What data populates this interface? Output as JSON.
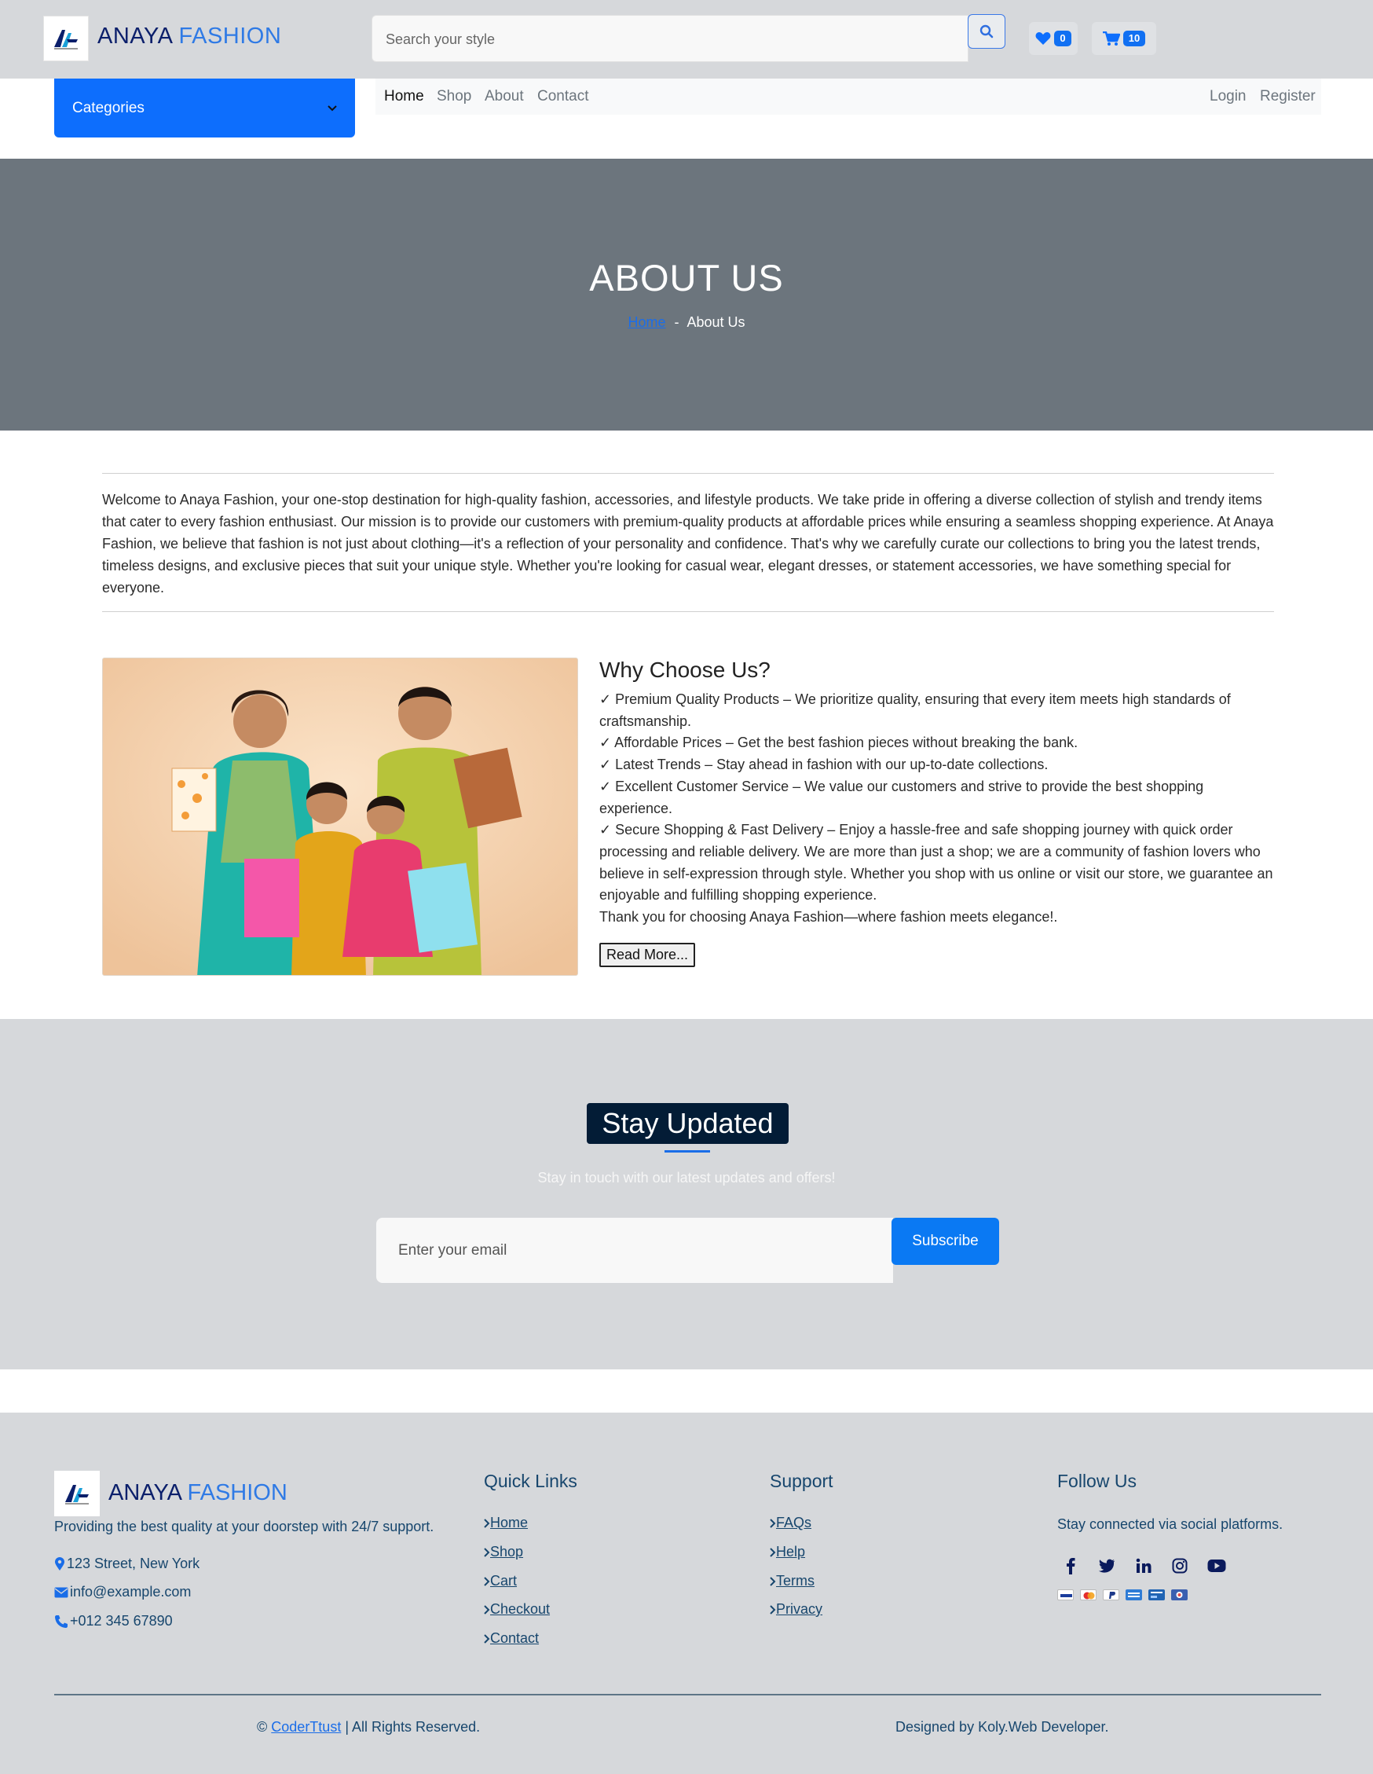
{
  "header": {
    "brand_part1": "ANAYA",
    "brand_part2": "FASHION",
    "search_placeholder": "Search your style",
    "wishlist_count": "0",
    "cart_count": "10"
  },
  "nav": {
    "categories_label": "Categories",
    "links": [
      "Home",
      "Shop",
      "About",
      "Contact"
    ],
    "active_link": "Home",
    "login_label": "Login",
    "register_label": "Register"
  },
  "hero": {
    "title": "ABOUT US",
    "breadcrumb_home": "Home",
    "breadcrumb_separator": "-",
    "breadcrumb_current": "About Us"
  },
  "about": {
    "intro": "Welcome to Anaya Fashion, your one-stop destination for high-quality fashion, accessories, and lifestyle products. We take pride in offering a diverse collection of stylish and trendy items that cater to every fashion enthusiast. Our mission is to provide our customers with premium-quality products at affordable prices while ensuring a seamless shopping experience. At Anaya Fashion, we believe that fashion is not just about clothing—it's a reflection of your personality and confidence. That's why we carefully curate our collections to bring you the latest trends, timeless designs, and exclusive pieces that suit your unique style. Whether you're looking for casual wear, elegant dresses, or statement accessories, we have something special for everyone.",
    "why_title": "Why Choose Us?",
    "why_points": [
      "✓ Premium Quality Products – We prioritize quality, ensuring that every item meets high standards of craftsmanship.",
      "✓ Affordable Prices – Get the best fashion pieces without breaking the bank.",
      "✓ Latest Trends – Stay ahead in fashion with our up-to-date collections.",
      "✓ Excellent Customer Service – We value our customers and strive to provide the best shopping experience.",
      "✓ Secure Shopping & Fast Delivery – Enjoy a hassle-free and safe shopping journey with quick order processing and reliable delivery. We are more than just a shop; we are a community of fashion lovers who believe in self-expression through style. Whether you shop with us online or visit our store, we guarantee an enjoyable and fulfilling shopping experience.",
      "Thank you for choosing Anaya Fashion—where fashion meets elegance!."
    ],
    "read_more": "Read More..."
  },
  "newsletter": {
    "title": "Stay Updated",
    "subtitle": "Stay in touch with our latest updates and offers!",
    "email_placeholder": "Enter your email",
    "subscribe_label": "Subscribe"
  },
  "footer": {
    "brand_part1": "ANAYA",
    "brand_part2": "FASHION",
    "tagline": "Providing the best quality at your doorstep with 24/7 support.",
    "address": "123 Street, New York",
    "email": "info@example.com",
    "phone": "+012 345 67890",
    "quick_links_title": "Quick Links",
    "quick_links": [
      "Home",
      "Shop",
      "Cart",
      "Checkout",
      "Contact"
    ],
    "support_title": "Support",
    "support_links": [
      "FAQs",
      "Help",
      "Terms",
      "Privacy"
    ],
    "follow_title": "Follow Us",
    "follow_text": "Stay connected via social platforms.",
    "social_icons": [
      "facebook-icon",
      "twitter-icon",
      "linkedin-icon",
      "instagram-icon",
      "youtube-icon"
    ],
    "payment_icons": [
      "visa-icon",
      "mastercard-icon",
      "paypal-icon",
      "amex-icon",
      "bank-card-icon",
      "diners-icon"
    ],
    "copyright_symbol": "©",
    "copyright_link": "CoderTtust",
    "copyright_rest": "| All Rights Reserved.",
    "designed_by": "Designed by Koly.Web Developer."
  },
  "colors": {
    "primary": "#0d6efd",
    "brand_dark": "#0b1f6b",
    "brand_light": "#2f7ae5",
    "header_bg": "#d6d8db",
    "hero_bg": "#6c757d",
    "newsletter_title_bg": "#031c36",
    "footer_text": "#17466d"
  }
}
